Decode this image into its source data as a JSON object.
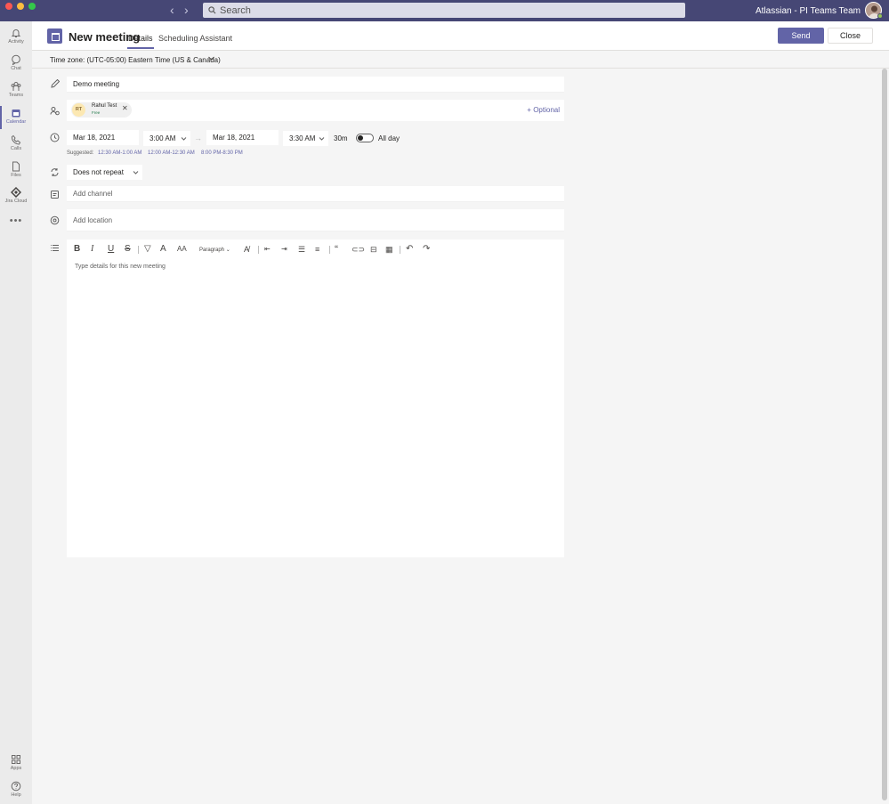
{
  "colors": {
    "brand": "#6264a7",
    "topbar": "#464775",
    "status_free": "#237b4b"
  },
  "topbar": {
    "search_placeholder": "Search",
    "org_name": "Atlassian - PI Teams Team"
  },
  "rail": {
    "items": [
      {
        "label": "Activity",
        "icon": "bell-icon"
      },
      {
        "label": "Chat",
        "icon": "chat-icon"
      },
      {
        "label": "Teams",
        "icon": "teams-icon"
      },
      {
        "label": "Calendar",
        "icon": "calendar-icon",
        "active": true
      },
      {
        "label": "Calls",
        "icon": "phone-icon"
      },
      {
        "label": "Files",
        "icon": "file-icon"
      },
      {
        "label": "Jira Cloud",
        "icon": "jira-icon"
      },
      {
        "label": "",
        "icon": "more-icon"
      }
    ],
    "bottom": [
      {
        "label": "Apps",
        "icon": "apps-icon"
      },
      {
        "label": "Help",
        "icon": "help-icon"
      }
    ]
  },
  "header": {
    "title": "New meeting",
    "tabs": [
      {
        "label": "Details",
        "active": true
      },
      {
        "label": "Scheduling Assistant",
        "active": false
      }
    ],
    "send_label": "Send",
    "close_label": "Close"
  },
  "timezone": {
    "label": "Time zone: (UTC-05:00) Eastern Time (US & Canada)"
  },
  "form": {
    "title_value": "Demo meeting",
    "attendee": {
      "initials": "RT",
      "name": "Rahul Test",
      "status": "Free"
    },
    "optional_label": "+ Optional",
    "start_date": "Mar 18, 2021",
    "start_time": "3:00 AM",
    "end_date": "Mar 18, 2021",
    "end_time": "3:30 AM",
    "duration": "30m",
    "all_day_label": "All day",
    "all_day": false,
    "suggested_label": "Suggested:",
    "suggested": [
      "12:30 AM-1:00 AM",
      "12:00 AM-12:30 AM",
      "8:00 PM-8:30 PM"
    ],
    "repeat": "Does not repeat",
    "channel_placeholder": "Add channel",
    "location_placeholder": "Add location",
    "paragraph_style": "Paragraph",
    "details_placeholder": "Type details for this new meeting"
  }
}
